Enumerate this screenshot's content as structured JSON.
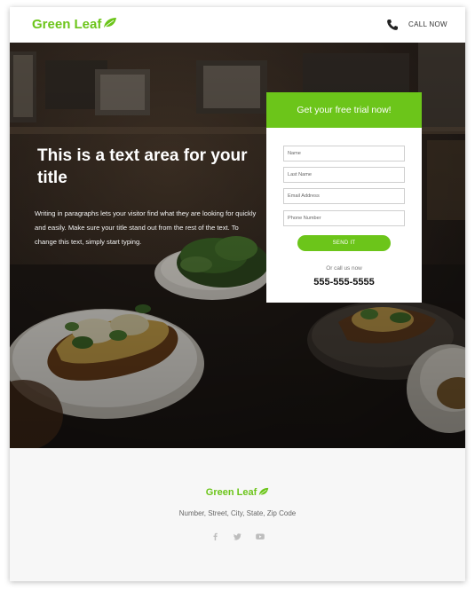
{
  "header": {
    "logo_text": "Green Leaf",
    "logo_icon": "leaf-icon",
    "phone_icon": "phone-icon",
    "call_label": "CALL NOW"
  },
  "hero": {
    "title": "This is a text area for your title",
    "body": "Writing in paragraphs lets your visitor find what they are looking for quickly and easily. Make sure your title stand out from the rest of the text. To change this text, simply start typing."
  },
  "form": {
    "heading": "Get your free trial now!",
    "fields": [
      {
        "placeholder": "Name"
      },
      {
        "placeholder": "Last Name"
      },
      {
        "placeholder": "Email Address"
      },
      {
        "placeholder": "Phone Number"
      }
    ],
    "submit_label": "SEND IT",
    "or_call": "Or call us now",
    "phone": "555-555-5555"
  },
  "footer": {
    "logo_text": "Green Leaf",
    "address": "Number, Street, City, State, Zip Code",
    "socials": [
      "facebook-icon",
      "twitter-icon",
      "youtube-icon"
    ]
  },
  "colors": {
    "brand_green": "#6cc51a",
    "footer_bg": "#f7f7f7",
    "hero_dark": "#1e1814"
  }
}
